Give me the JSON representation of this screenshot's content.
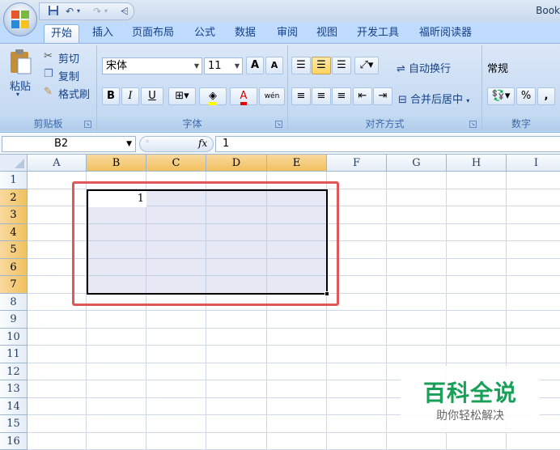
{
  "app": {
    "title": "Book"
  },
  "qat": {
    "save_icon": "save-icon",
    "undo": "↶",
    "redo": "↷",
    "more": "⩤"
  },
  "tabs": [
    {
      "label": "开始"
    },
    {
      "label": "插入"
    },
    {
      "label": "页面布局"
    },
    {
      "label": "公式"
    },
    {
      "label": "数据"
    },
    {
      "label": "审阅"
    },
    {
      "label": "视图"
    },
    {
      "label": "开发工具"
    },
    {
      "label": "福昕阅读器"
    }
  ],
  "ribbon": {
    "clipboard": {
      "paste": "粘贴",
      "cut": "剪切",
      "copy": "复制",
      "format_painter": "格式刷",
      "label": "剪贴板"
    },
    "font": {
      "name": "宋体",
      "size": "11",
      "bold": "B",
      "italic": "I",
      "underline": "U",
      "grow": "A",
      "shrink": "A",
      "phonetic": "wén",
      "label": "字体"
    },
    "alignment": {
      "wrap_text": "自动换行",
      "merge_center": "合并后居中",
      "label": "对齐方式"
    },
    "number": {
      "format": "常规",
      "percent": "%",
      "comma": ",",
      "label": "数字"
    }
  },
  "formula_bar": {
    "name_box": "B2",
    "fx": "fx",
    "value": "1"
  },
  "grid": {
    "columns": [
      "A",
      "B",
      "C",
      "D",
      "E",
      "F",
      "G",
      "H",
      "I"
    ],
    "rows": [
      "1",
      "2",
      "3",
      "4",
      "5",
      "6",
      "7",
      "8",
      "9",
      "10",
      "11",
      "12",
      "13",
      "14",
      "15",
      "16"
    ],
    "selected_columns": [
      "B",
      "C",
      "D",
      "E"
    ],
    "selected_rows": [
      "2",
      "3",
      "4",
      "5",
      "6",
      "7"
    ],
    "cell_b2": "1"
  },
  "watermark": {
    "title": "百科全说",
    "subtitle": "助你轻松解决"
  },
  "colors": {
    "accent_highlight": "#e0575a",
    "watermark_green": "#18a058",
    "selection_header": "#f1c15f"
  }
}
